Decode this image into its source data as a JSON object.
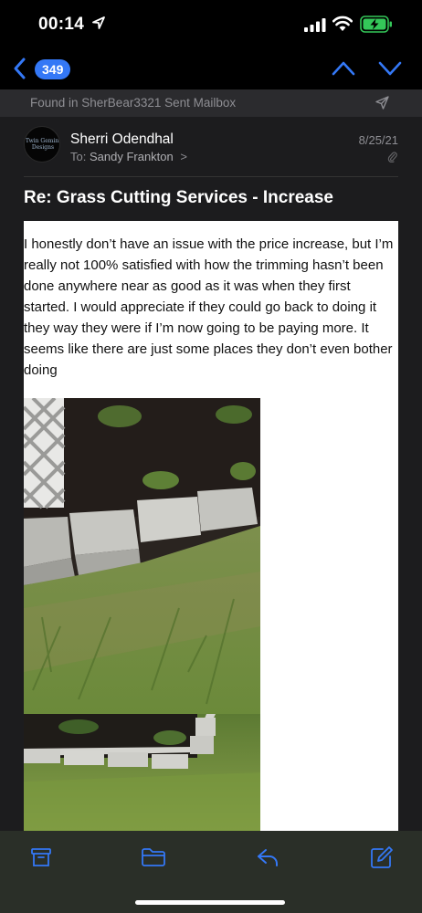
{
  "status_bar": {
    "time": "00:14"
  },
  "nav": {
    "message_count": "349"
  },
  "found_banner": {
    "text": "Found in SherBear3321 Sent Mailbox"
  },
  "message": {
    "avatar_text": "Twin Gemini Designs",
    "sender": "Sherri Odendhal",
    "to_label": "To:",
    "to_name": "Sandy Frankton",
    "to_chevron": ">",
    "date": "8/25/21",
    "subject": "Re: Grass Cutting Services - Increase",
    "body": "I honestly don’t have an issue with the price increase, but I’m really not 100% satisfied with how the trimming hasn’t been done anywhere near as good as it was when they first started. I would appreciate if they could go back to doing it they way they were if I’m now going to be paying more. It seems like there are just some places they don’t even bother doing"
  },
  "icons": {
    "location": "location-arrow-icon",
    "signal": "cellular-signal-icon",
    "wifi": "wifi-icon",
    "battery": "battery-charging-icon",
    "back": "chevron-left-icon",
    "prev": "chevron-up-icon",
    "next": "chevron-down-icon",
    "send": "send-icon",
    "attachment": "paperclip-icon",
    "archive": "archive-icon",
    "folder": "folder-icon",
    "reply": "reply-icon",
    "compose": "compose-icon"
  },
  "colors": {
    "accent": "#3478f6",
    "battery": "#34c759",
    "background": "#000000",
    "found_bar": "#2b2b2e",
    "message_area": "#1c1c1e",
    "toolbar": "#2a2f28"
  }
}
